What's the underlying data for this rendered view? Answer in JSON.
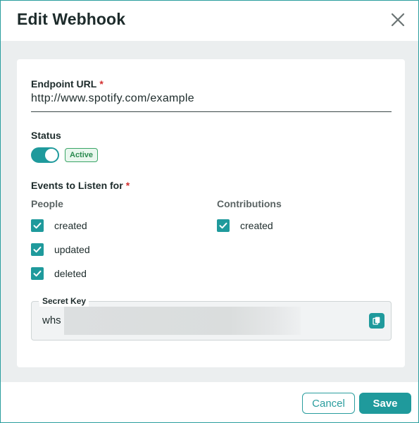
{
  "dialog": {
    "title": "Edit Webhook",
    "close_icon": "close-icon"
  },
  "endpoint": {
    "label": "Endpoint URL",
    "required_marker": "*",
    "value": "http://www.spotify.com/example"
  },
  "status": {
    "label": "Status",
    "toggle_on": true,
    "badge": "Active"
  },
  "events": {
    "label": "Events to Listen for",
    "required_marker": "*",
    "groups": [
      {
        "heading": "People",
        "items": [
          {
            "label": "created",
            "checked": true
          },
          {
            "label": "updated",
            "checked": true
          },
          {
            "label": "deleted",
            "checked": true
          }
        ]
      },
      {
        "heading": "Contributions",
        "items": [
          {
            "label": "created",
            "checked": true
          }
        ]
      }
    ]
  },
  "secret_key": {
    "label": "Secret Key",
    "visible_prefix": "whs",
    "copy_icon": "copy-icon"
  },
  "footer": {
    "cancel_label": "Cancel",
    "save_label": "Save"
  },
  "colors": {
    "accent": "#1f9a9c",
    "required": "#d32f2f",
    "badge_text": "#2a8a4f",
    "badge_border": "#3aa566",
    "badge_bg": "#e9f7ee",
    "body_bg": "#ebeeef"
  }
}
